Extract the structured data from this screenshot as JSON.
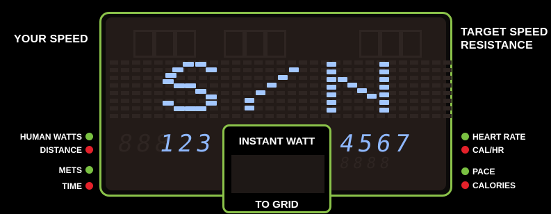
{
  "left_panel": {
    "title": "YOUR SPEED",
    "indicators": [
      {
        "label": "HUMAN WATTS",
        "color": "#7ac142"
      },
      {
        "label": "DISTANCE",
        "color": "#e4212a"
      },
      {
        "label": "METS",
        "color": "#7ac142"
      },
      {
        "label": "TIME",
        "color": "#e4212a"
      }
    ]
  },
  "right_panel": {
    "title_line1": "TARGET SPEED",
    "title_line2": "RESISTANCE",
    "indicators": [
      {
        "label": "HEART RATE",
        "color": "#7ac142"
      },
      {
        "label": "CAL/HR",
        "color": "#e4212a"
      },
      {
        "label": "PACE",
        "color": "#7ac142"
      },
      {
        "label": "CALORIES",
        "color": "#e4212a"
      }
    ]
  },
  "display": {
    "main_text": "S/N",
    "left_value": "123",
    "right_value": "4567",
    "bezel_color": "#8bc34a",
    "segment_color": "#a4c8ff"
  },
  "instant_watt": {
    "title": "INSTANT WATT",
    "footer": "TO GRID"
  }
}
